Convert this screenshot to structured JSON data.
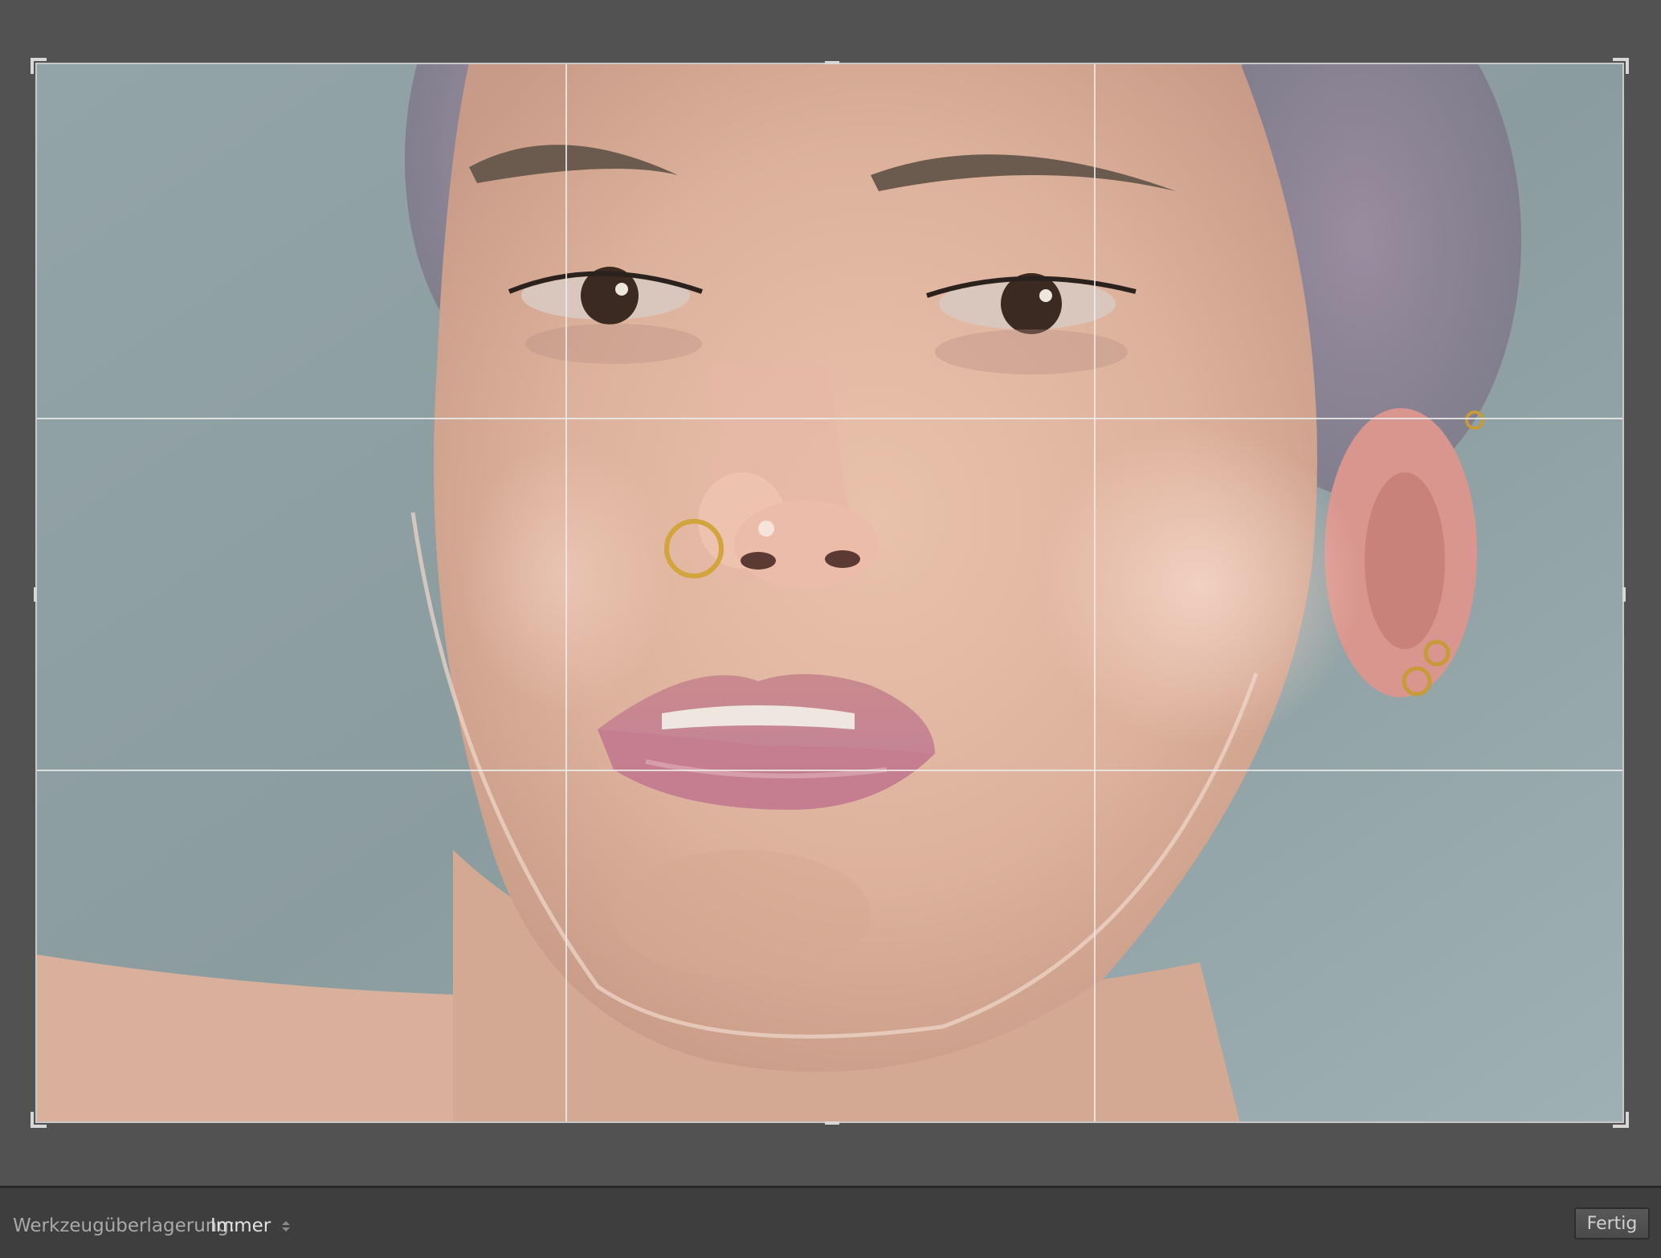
{
  "toolbar": {
    "overlay_label": "Werkzeugüberlagerung:",
    "overlay_value": "Immer",
    "done_label": "Fertig"
  },
  "crop": {
    "overlay": "rule-of-thirds-grid",
    "frame_color": "#c8c8c8"
  },
  "colors": {
    "workspace_bg": "#525252",
    "toolbar_bg": "#3e3e3e",
    "label_text": "#a9a9a9",
    "value_text": "#e2e2e2"
  }
}
